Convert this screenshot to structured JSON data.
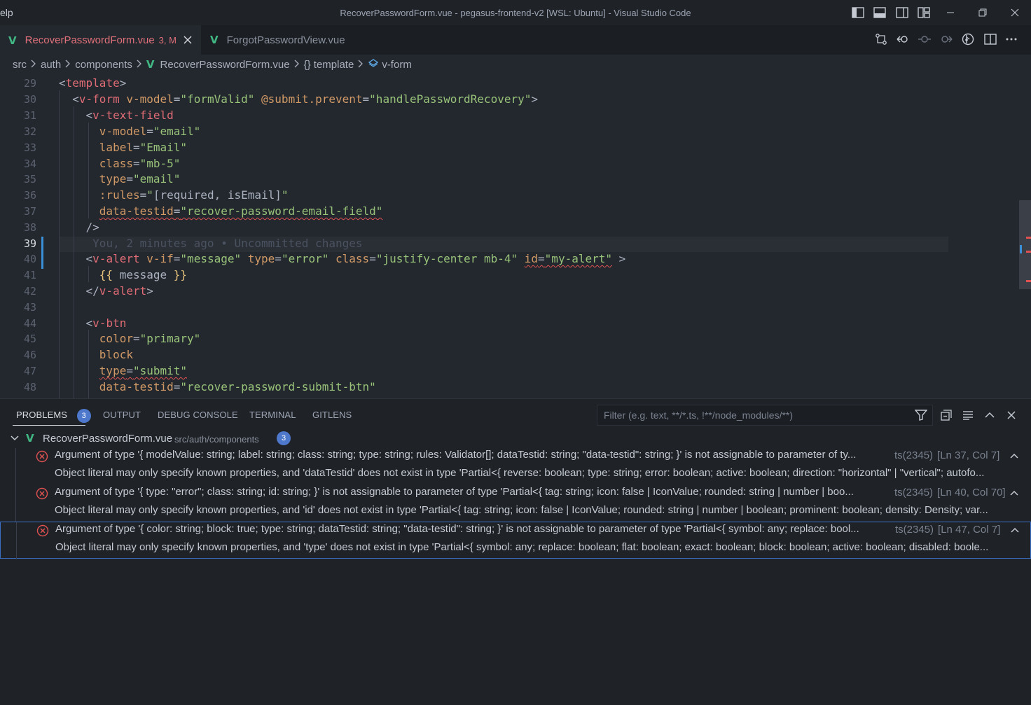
{
  "titlebar": {
    "menu_partial": "elp",
    "title": "RecoverPasswordForm.vue - pegasus-frontend-v2 [WSL: Ubuntu] - Visual Studio Code"
  },
  "tabs": [
    {
      "label": "RecoverPasswordForm.vue",
      "status": "3, M",
      "active": true
    },
    {
      "label": "ForgotPasswordView.vue",
      "active": false
    }
  ],
  "breadcrumb": {
    "items": [
      "src",
      "auth",
      "components",
      "RecoverPasswordForm.vue",
      "{} template",
      "v-form"
    ]
  },
  "editor": {
    "line_numbers": [
      "29",
      "30",
      "31",
      "32",
      "33",
      "34",
      "35",
      "36",
      "37",
      "38",
      "39",
      "40",
      "41",
      "42",
      "43",
      "44",
      "45",
      "46",
      "47",
      "48"
    ],
    "current_line": "39",
    "blame": "You, 2 minutes ago • Uncommitted changes",
    "code": {
      "l29_tag": "template",
      "l30_tag": "v-form",
      "l30_a1": "v-model",
      "l30_v1": "\"formValid\"",
      "l30_a2": "@submit.prevent",
      "l30_v2": "\"handlePasswordRecovery\"",
      "l31_tag": "v-text-field",
      "l32_a": "v-model",
      "l32_v": "\"email\"",
      "l33_a": "label",
      "l33_v": "\"Email\"",
      "l34_a": "class",
      "l34_v": "\"mb-5\"",
      "l35_a": "type",
      "l35_v": "\"email\"",
      "l36_a": ":rules",
      "l36_v1": "\"",
      "l36_expr": "[required, isEmail]",
      "l36_v2": "\"",
      "l37_a": "data-testid",
      "l37_v": "\"recover-password-email-field\"",
      "l38": "/>",
      "l40_tag": "v-alert",
      "l40_a1": "v-if",
      "l40_v1": "\"message\"",
      "l40_a2": "type",
      "l40_v2": "\"error\"",
      "l40_a3": "class",
      "l40_v3": "\"justify-center mb-4\"",
      "l40_a4": "id",
      "l40_v4": "\"my-alert\"",
      "l41_open": "{{",
      "l41_expr": " message ",
      "l41_close": "}}",
      "l42_tag": "v-alert",
      "l44_tag": "v-btn",
      "l45_a": "color",
      "l45_v": "\"primary\"",
      "l46_a": "block",
      "l47_a": "type",
      "l47_v": "\"submit\"",
      "l48_a": "data-testid",
      "l48_v": "\"recover-password-submit-btn\""
    }
  },
  "panel": {
    "tabs": [
      "PROBLEMS",
      "OUTPUT",
      "DEBUG CONSOLE",
      "TERMINAL",
      "GITLENS"
    ],
    "problems_count": "3",
    "filter_placeholder": "Filter (e.g. text, **/*.ts, !**/node_modules/**)",
    "file": {
      "name": "RecoverPasswordForm.vue",
      "path": "src/auth/components",
      "count": "3"
    },
    "problems": [
      {
        "message": "Argument of type '{ modelValue: string; label: string; class: string; type: string; rules: Validator[]; dataTestid: string; \"data-testid\": string; }' is not assignable to parameter of ty...",
        "code": "ts(2345)",
        "location": "[Ln 37, Col 7]",
        "detail": "Object literal may only specify known properties, and 'dataTestid' does not exist in type 'Partial<{ reverse: boolean; type: string; error: boolean; active: boolean; direction: \"horizontal\" | \"vertical\"; autofo..."
      },
      {
        "message": "Argument of type '{ type: \"error\"; class: string; id: string; }' is not assignable to parameter of type 'Partial<{ tag: string; icon: false | IconValue; rounded: string | number | boo...",
        "code": "ts(2345)",
        "location": "[Ln 40, Col 70]",
        "detail": "Object literal may only specify known properties, and 'id' does not exist in type 'Partial<{ tag: string; icon: false | IconValue; rounded: string | number | boolean; prominent: boolean; density: Density; var..."
      },
      {
        "message": "Argument of type '{ color: string; block: true; type: string; dataTestid: string; \"data-testid\": string; }' is not assignable to parameter of type 'Partial<{ symbol: any; replace: bool...",
        "code": "ts(2345)",
        "location": "[Ln 47, Col 7]",
        "detail": "Object literal may only specify known properties, and 'type' does not exist in type 'Partial<{ symbol: any; replace: boolean; flat: boolean; exact: boolean; block: boolean; active: boolean; disabled: boole..."
      }
    ]
  },
  "colors": {
    "background": "#23272e",
    "tag": "#e06c75",
    "attribute": "#d19a66",
    "string": "#98c379",
    "error": "#e05252",
    "badge": "#4d78cc",
    "vue": "#41b883"
  }
}
